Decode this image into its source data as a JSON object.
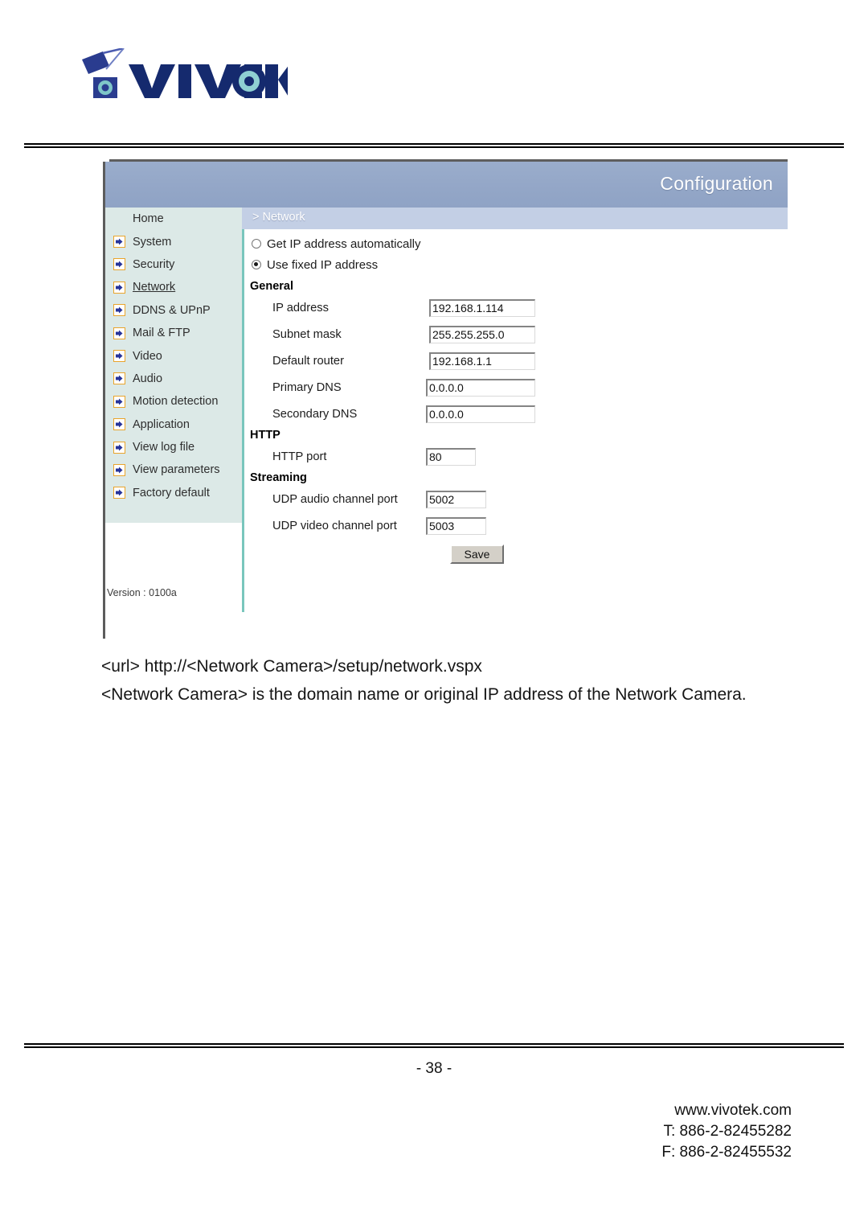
{
  "brand": {
    "logo_text": "VIVOTEK",
    "logo_icon": "vivotek-camera-logo"
  },
  "config_panel": {
    "header": {
      "title": "Configuration"
    },
    "subnav": {
      "label": "> Network"
    },
    "sidebar": {
      "items": [
        {
          "label": "Home",
          "icon": "none",
          "current": false
        },
        {
          "label": "System",
          "icon": "arrow-right-icon",
          "current": false
        },
        {
          "label": "Security",
          "icon": "arrow-right-icon",
          "current": false
        },
        {
          "label": "Network",
          "icon": "arrow-right-icon",
          "current": true
        },
        {
          "label": "DDNS & UPnP",
          "icon": "arrow-right-icon",
          "current": false
        },
        {
          "label": "Mail & FTP",
          "icon": "arrow-right-icon",
          "current": false
        },
        {
          "label": "Video",
          "icon": "arrow-right-icon",
          "current": false
        },
        {
          "label": "Audio",
          "icon": "arrow-right-icon",
          "current": false
        },
        {
          "label": "Motion detection",
          "icon": "arrow-right-icon",
          "current": false
        },
        {
          "label": "Application",
          "icon": "arrow-right-icon",
          "current": false
        },
        {
          "label": "View log file",
          "icon": "arrow-right-icon",
          "current": false
        },
        {
          "label": "View parameters",
          "icon": "arrow-right-icon",
          "current": false
        },
        {
          "label": "Factory default",
          "icon": "arrow-right-icon",
          "current": false
        }
      ],
      "version": "Version : 0100a"
    },
    "form": {
      "ip_mode": {
        "auto": {
          "label": "Get IP address automatically",
          "selected": false
        },
        "fixed": {
          "label": "Use fixed IP address",
          "selected": true
        }
      },
      "general": {
        "title": "General",
        "fields": [
          {
            "label": "IP address",
            "value": "192.168.1.114"
          },
          {
            "label": "Subnet mask",
            "value": "255.255.255.0"
          },
          {
            "label": "Default router",
            "value": "192.168.1.1"
          },
          {
            "label": "Primary DNS",
            "value": "0.0.0.0"
          },
          {
            "label": "Secondary DNS",
            "value": "0.0.0.0"
          }
        ]
      },
      "http": {
        "title": "HTTP",
        "fields": [
          {
            "label": "HTTP port",
            "value": "80"
          }
        ]
      },
      "streaming": {
        "title": "Streaming",
        "fields": [
          {
            "label": "UDP audio channel port",
            "value": "5002"
          },
          {
            "label": "UDP video channel port",
            "value": "5003"
          }
        ]
      },
      "save_label": "Save"
    },
    "colors": {
      "header_blue": "#93a6c7",
      "subnav_blue": "#c3cfe5",
      "sidebar_mint": "#dce9e7",
      "teal_rule": "#79c6bd",
      "icon_border_orange": "#e9a42c",
      "icon_arrow_blue": "#27349a"
    }
  },
  "body_text": {
    "line1": "<url> http://<Network Camera>/setup/network.vspx",
    "line2": "<Network Camera> is the domain name or original IP address of the Network Camera."
  },
  "footer": {
    "page_number": "- 38 -",
    "website": "www.vivotek.com",
    "telephone": "T: 886-2-82455282",
    "fax": "F: 886-2-82455532"
  }
}
